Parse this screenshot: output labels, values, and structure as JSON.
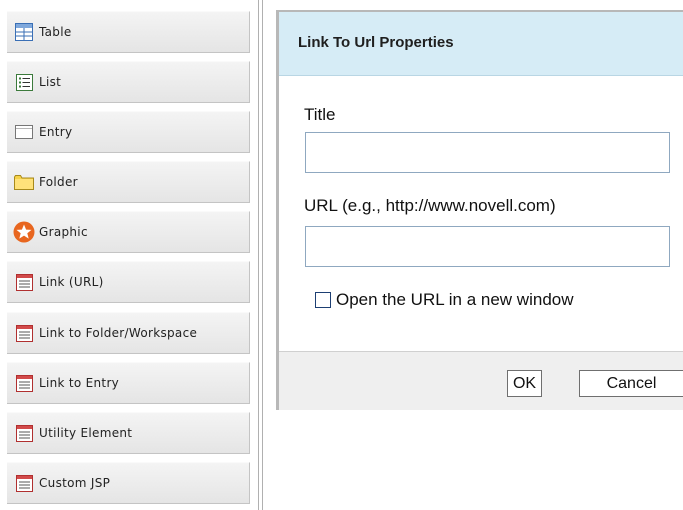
{
  "palette": {
    "items": [
      {
        "label": "Table",
        "icon": "table-icon"
      },
      {
        "label": "List",
        "icon": "list-icon"
      },
      {
        "label": "Entry",
        "icon": "entry-icon"
      },
      {
        "label": "Folder",
        "icon": "folder-icon"
      },
      {
        "label": "Graphic",
        "icon": "graphic-icon"
      },
      {
        "label": "Link (URL)",
        "icon": "link-url-icon"
      },
      {
        "label": "Link to Folder/Workspace",
        "icon": "link-folder-workspace-icon"
      },
      {
        "label": "Link to Entry",
        "icon": "link-entry-icon"
      },
      {
        "label": "Utility Element",
        "icon": "utility-element-icon"
      },
      {
        "label": "Custom JSP",
        "icon": "custom-jsp-icon"
      }
    ]
  },
  "dialog": {
    "title": "Link To Url Properties",
    "title_field": {
      "label": "Title",
      "value": ""
    },
    "url_field": {
      "label": "URL (e.g., http://www.novell.com)",
      "value": ""
    },
    "new_window_checkbox": {
      "label": "Open the URL in a new window",
      "checked": false
    },
    "ok_label": "OK",
    "cancel_label": "Cancel"
  },
  "colors": {
    "dialog_header_bg": "#d6ecf6",
    "input_border": "#8fa8c0",
    "palette_bg": "#e5e5e5",
    "checkbox_border": "#1d3f73"
  }
}
